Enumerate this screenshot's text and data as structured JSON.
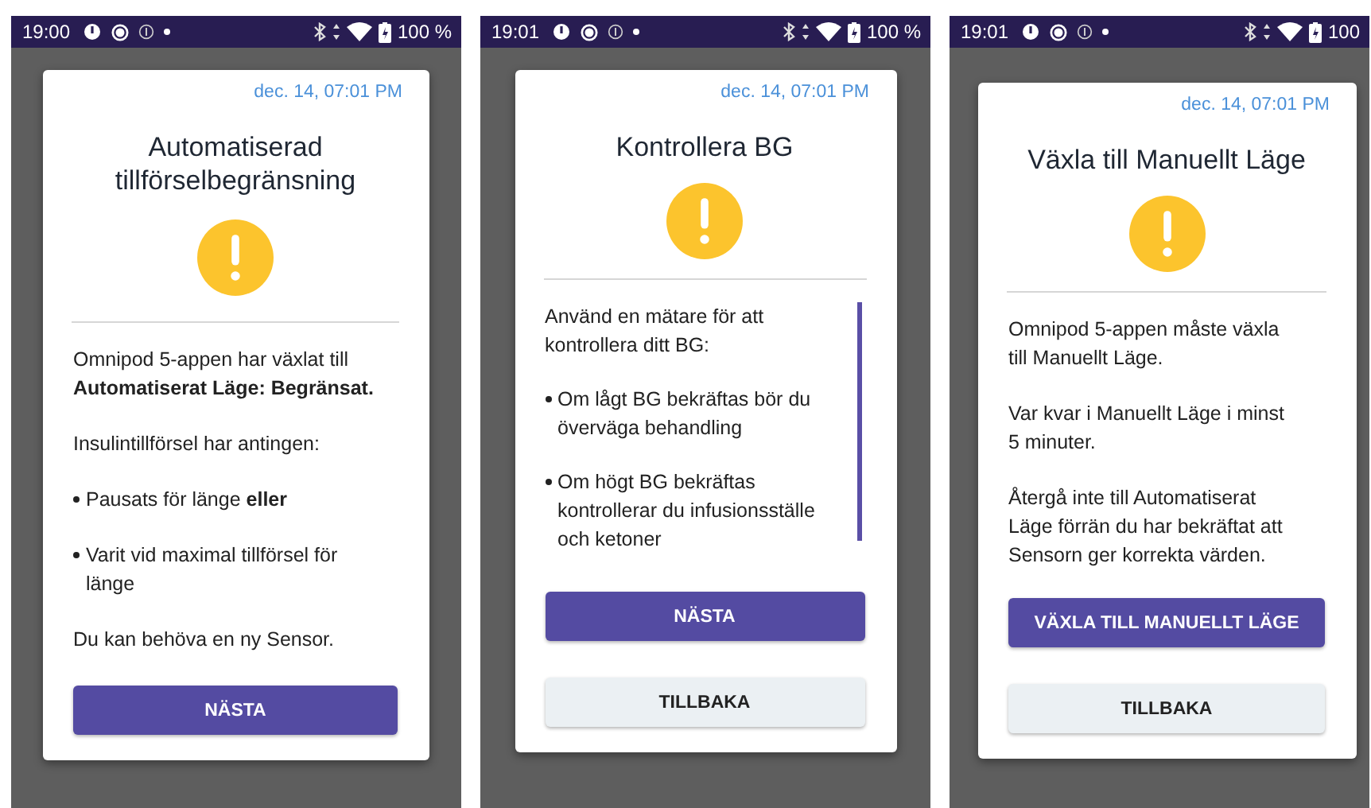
{
  "screens": [
    {
      "status_bar": {
        "time": "19:00",
        "battery": "100 %"
      },
      "dialog": {
        "timestamp": "dec. 14, 07:01 PM",
        "title": "Automatiserad tillförselbegränsning",
        "scrollable": false,
        "paragraphs": [
          {
            "kind": "text",
            "text": "Omnipod 5-appen har växlat till **Automatiserat Läge: Begränsat.**"
          },
          {
            "kind": "text",
            "text": "Insulintillförsel har antingen:"
          },
          {
            "kind": "bullet",
            "text": "Pausats för länge **eller**"
          },
          {
            "kind": "bullet",
            "text": "Varit vid maximal tillförsel för länge"
          },
          {
            "kind": "text",
            "text": "Du kan behöva en ny Sensor."
          }
        ],
        "buttons": [
          {
            "label": "NÄSTA",
            "kind": "primary"
          }
        ]
      }
    },
    {
      "status_bar": {
        "time": "19:01",
        "battery": "100 %"
      },
      "dialog": {
        "timestamp": "dec. 14, 07:01 PM",
        "title": "Kontrollera BG",
        "scrollable": true,
        "paragraphs": [
          {
            "kind": "text",
            "text": "Använd en mätare för att kontrollera ditt BG:"
          },
          {
            "kind": "bullet",
            "text": "Om lågt BG bekräftas bör du överväga behandling"
          },
          {
            "kind": "bullet",
            "text": "Om högt BG bekräftas kontrollerar du infusionsställe och ketoner"
          }
        ],
        "buttons": [
          {
            "label": "NÄSTA",
            "kind": "primary"
          },
          {
            "label": "TILLBAKA",
            "kind": "secondary"
          }
        ]
      }
    },
    {
      "status_bar": {
        "time": "19:01",
        "battery": "100"
      },
      "dialog": {
        "timestamp": "dec. 14, 07:01 PM",
        "title": "Växla till Manuellt Läge",
        "scrollable": false,
        "paragraphs": [
          {
            "kind": "text",
            "text": "Omnipod 5-appen måste växla till Manuellt Läge."
          },
          {
            "kind": "text",
            "text": "Var kvar i Manuellt Läge i minst 5 minuter."
          },
          {
            "kind": "text",
            "text": "Återgå inte till Automatiserat Läge förrän du har bekräftat att Sensorn ger korrekta värden."
          }
        ],
        "buttons": [
          {
            "label": "VÄXLA TILL MANUELLT LÄGE",
            "kind": "primary"
          },
          {
            "label": "TILLBAKA",
            "kind": "secondary"
          }
        ]
      }
    }
  ]
}
